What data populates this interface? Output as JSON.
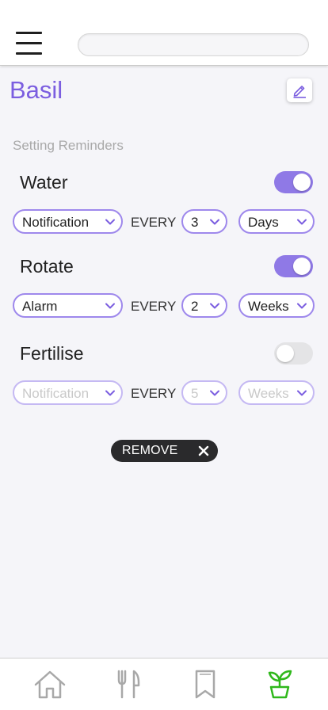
{
  "header": {
    "search": {
      "value": "",
      "placeholder": ""
    }
  },
  "plant": {
    "name": "Basil"
  },
  "section_label": "Setting Reminders",
  "every_label": "EVERY",
  "reminders": [
    {
      "name": "Water",
      "enabled": true,
      "type": "Notification",
      "interval": "3",
      "unit": "Days"
    },
    {
      "name": "Rotate",
      "enabled": true,
      "type": "Alarm",
      "interval": "2",
      "unit": "Weeks"
    },
    {
      "name": "Fertilise",
      "enabled": false,
      "type": "Notification",
      "interval": "5",
      "unit": "Weeks"
    }
  ],
  "remove_label": "REMOVE",
  "colors": {
    "accent": "#7b5ee0",
    "toggle_on": "#8f79e6",
    "select_border": "#9e88ec",
    "active_nav": "#2fb81b",
    "inactive_nav": "#a8a8a8"
  },
  "nav": [
    {
      "icon": "home-icon",
      "active": false
    },
    {
      "icon": "fork-knife-icon",
      "active": false
    },
    {
      "icon": "bookmark-icon",
      "active": false
    },
    {
      "icon": "plant-icon",
      "active": true
    }
  ]
}
